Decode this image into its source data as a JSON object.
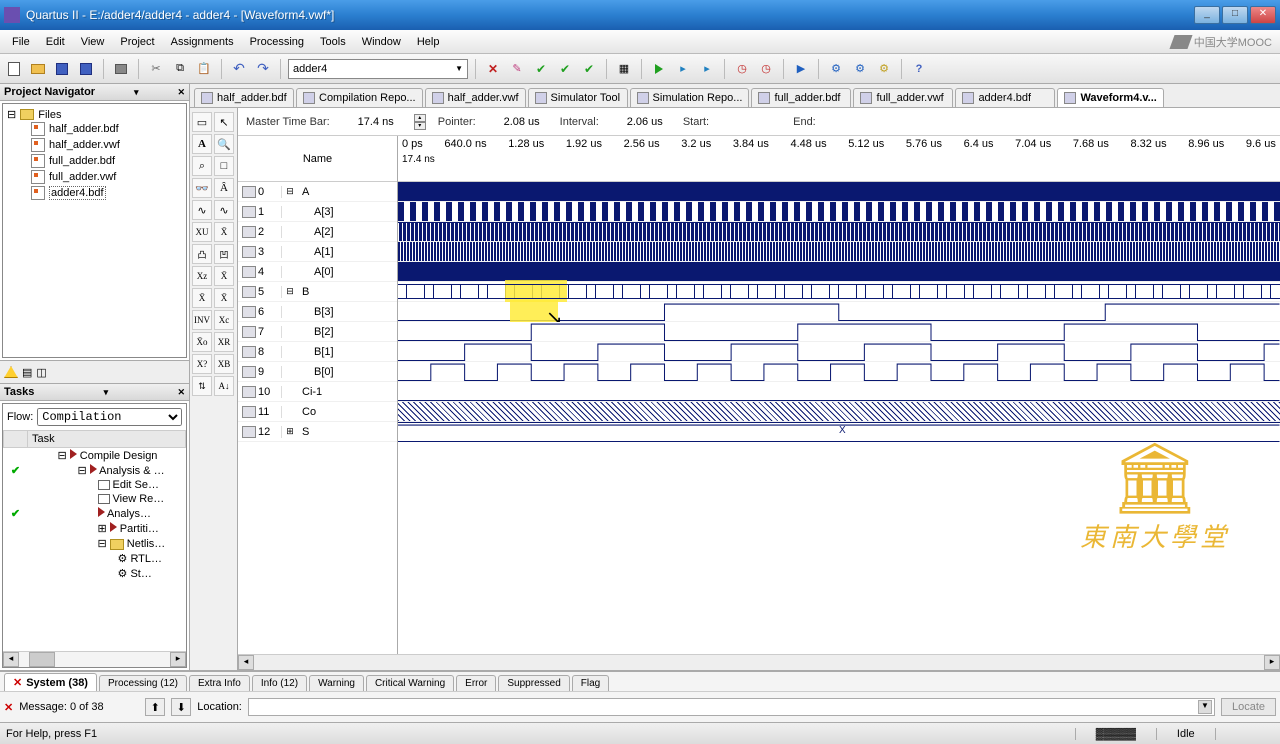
{
  "window": {
    "title": "Quartus II - E:/adder4/adder4 - adder4 - [Waveform4.vwf*]",
    "min": "_",
    "max": "□",
    "close": "✕"
  },
  "menubar": [
    "File",
    "Edit",
    "View",
    "Project",
    "Assignments",
    "Processing",
    "Tools",
    "Window",
    "Help"
  ],
  "mooc_text": "中国大学MOOC",
  "toolbar": {
    "project_select": "adder4"
  },
  "project_nav": {
    "title": "Project Navigator",
    "root": "Files",
    "files": [
      "half_adder.bdf",
      "half_adder.vwf",
      "full_adder.bdf",
      "full_adder.vwf",
      "adder4.bdf"
    ],
    "selected": "adder4.bdf"
  },
  "tasks": {
    "title": "Tasks",
    "flow_label": "Flow:",
    "flow_value": "Compilation",
    "header": "Task",
    "items": [
      {
        "check": true,
        "indent": 1,
        "icon": "tri",
        "label": "Compile Design"
      },
      {
        "check": true,
        "indent": 2,
        "icon": "tri",
        "label": "Analysis & …"
      },
      {
        "check": false,
        "indent": 3,
        "icon": "box",
        "label": "Edit Se…"
      },
      {
        "check": false,
        "indent": 3,
        "icon": "box",
        "label": "View Re…"
      },
      {
        "check": true,
        "indent": 3,
        "icon": "tri",
        "label": "Analys…"
      },
      {
        "check": false,
        "indent": 3,
        "icon": "tri",
        "label": "Partiti…"
      },
      {
        "check": false,
        "indent": 3,
        "icon": "folder",
        "label": "Netlis…"
      },
      {
        "check": false,
        "indent": 4,
        "icon": "gear",
        "label": "RTL…"
      },
      {
        "check": false,
        "indent": 4,
        "icon": "gear",
        "label": "St…"
      }
    ]
  },
  "doctabs": [
    {
      "label": "half_adder.bdf",
      "active": false
    },
    {
      "label": "Compilation Repo...",
      "active": false
    },
    {
      "label": "half_adder.vwf",
      "active": false
    },
    {
      "label": "Simulator Tool",
      "active": false
    },
    {
      "label": "Simulation Repo...",
      "active": false
    },
    {
      "label": "full_adder.bdf",
      "active": false
    },
    {
      "label": "full_adder.vwf",
      "active": false
    },
    {
      "label": "adder4.bdf",
      "active": false
    },
    {
      "label": "Waveform4.v...",
      "active": true
    }
  ],
  "waveinfo": {
    "mtb_label": "Master Time Bar:",
    "mtb_value": "17.4 ns",
    "ptr_label": "Pointer:",
    "ptr_value": "2.08 us",
    "int_label": "Interval:",
    "int_value": "2.06 us",
    "start_label": "Start:",
    "end_label": "End:"
  },
  "name_header": "Name",
  "time_marker": "17.4 ns",
  "time_ticks": [
    "0 ps",
    "640.0 ns",
    "1.28 us",
    "1.92 us",
    "2.56 us",
    "3.2 us",
    "3.84 us",
    "4.48 us",
    "5.12 us",
    "5.76 us",
    "6.4 us",
    "7.04 us",
    "7.68 us",
    "8.32 us",
    "8.96 us",
    "9.6 us"
  ],
  "signals": [
    {
      "idx": "0",
      "exp": "⊟",
      "name": "A",
      "type": "bus"
    },
    {
      "idx": "1",
      "exp": "",
      "name": "A[3]",
      "type": "sub"
    },
    {
      "idx": "2",
      "exp": "",
      "name": "A[2]",
      "type": "sub"
    },
    {
      "idx": "3",
      "exp": "",
      "name": "A[1]",
      "type": "sub"
    },
    {
      "idx": "4",
      "exp": "",
      "name": "A[0]",
      "type": "sub"
    },
    {
      "idx": "5",
      "exp": "⊟",
      "name": "B",
      "type": "bus"
    },
    {
      "idx": "6",
      "exp": "",
      "name": "B[3]",
      "type": "sub"
    },
    {
      "idx": "7",
      "exp": "",
      "name": "B[2]",
      "type": "sub"
    },
    {
      "idx": "8",
      "exp": "",
      "name": "B[1]",
      "type": "sub"
    },
    {
      "idx": "9",
      "exp": "",
      "name": "B[0]",
      "type": "sub"
    },
    {
      "idx": "10",
      "exp": "",
      "name": "Ci-1",
      "type": "sig"
    },
    {
      "idx": "11",
      "exp": "",
      "name": "Co",
      "type": "sig"
    },
    {
      "idx": "12",
      "exp": "⊞",
      "name": "S",
      "type": "bus"
    }
  ],
  "center_x": "X",
  "msgtabs": [
    "System (38)",
    "Processing (12)",
    "Extra Info",
    "Info (12)",
    "Warning",
    "Critical Warning",
    "Error",
    "Suppressed",
    "Flag"
  ],
  "msg": {
    "label": "Message: 0 of 38",
    "loc_label": "Location:",
    "locate": "Locate"
  },
  "statusbar": {
    "help": "For Help, press F1",
    "idle": "Idle"
  },
  "watermark": "東南大學堂"
}
